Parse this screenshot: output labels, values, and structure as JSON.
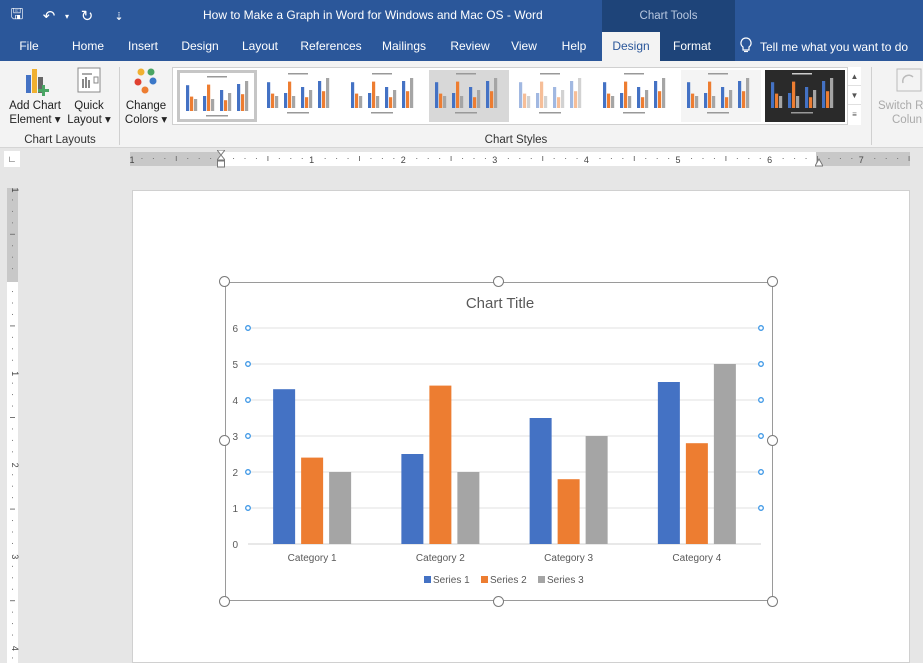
{
  "window": {
    "title": "How to Make a Graph in Word for Windows and Mac OS  -  Word",
    "contextual_group": "Chart Tools",
    "qat": [
      {
        "icon": "save-icon",
        "glyph": "🖫"
      },
      {
        "icon": "undo-icon",
        "glyph": "↶"
      },
      {
        "icon": "redo-icon",
        "glyph": "↻"
      },
      {
        "icon": "customize-qat-icon",
        "glyph": "⇣"
      }
    ]
  },
  "tabs": [
    {
      "label": "File"
    },
    {
      "label": "Home"
    },
    {
      "label": "Insert"
    },
    {
      "label": "Design"
    },
    {
      "label": "Layout"
    },
    {
      "label": "References"
    },
    {
      "label": "Mailings"
    },
    {
      "label": "Review"
    },
    {
      "label": "View"
    },
    {
      "label": "Help"
    },
    {
      "label": "Design",
      "active": true
    },
    {
      "label": "Format"
    }
  ],
  "tell_me": {
    "icon": "lightbulb-icon",
    "label": "Tell me what you want to do"
  },
  "ribbon": {
    "chart_layouts": {
      "group_label": "Chart Layouts",
      "add_chart_element": {
        "line1": "Add Chart",
        "line2": "Element ▾"
      },
      "quick_layout": {
        "line1": "Quick",
        "line2": "Layout ▾"
      }
    },
    "change_colors": {
      "line1": "Change",
      "line2": "Colors ▾"
    },
    "chart_styles": {
      "group_label": "Chart Styles",
      "style_count": 8,
      "selected_index": 0
    },
    "switch_row_column": {
      "line1": "Switch R",
      "line2": "Colun"
    }
  },
  "ruler": {
    "horizontal_labels": [
      "1",
      "1",
      "2",
      "3",
      "4",
      "5",
      "6",
      "7"
    ],
    "vertical_labels": [
      "1",
      "1",
      "2",
      "3",
      "4"
    ]
  },
  "colors": {
    "series1": "#4472c4",
    "series2": "#ed7d31",
    "series3": "#a5a5a5",
    "ribbon_blue": "#2b579a"
  },
  "chart_data": {
    "type": "bar",
    "title": "Chart Title",
    "categories": [
      "Category 1",
      "Category 2",
      "Category 3",
      "Category 4"
    ],
    "series": [
      {
        "name": "Series 1",
        "values": [
          4.3,
          2.5,
          3.5,
          4.5
        ]
      },
      {
        "name": "Series 2",
        "values": [
          2.4,
          4.4,
          1.8,
          2.8
        ]
      },
      {
        "name": "Series 3",
        "values": [
          2,
          2,
          3,
          5
        ]
      }
    ],
    "xlabel": "",
    "ylabel": "",
    "ylim": [
      0,
      6
    ],
    "yticks": [
      "0",
      "1",
      "2",
      "3",
      "4",
      "5",
      "6"
    ],
    "grid": true,
    "legend": "bottom"
  }
}
